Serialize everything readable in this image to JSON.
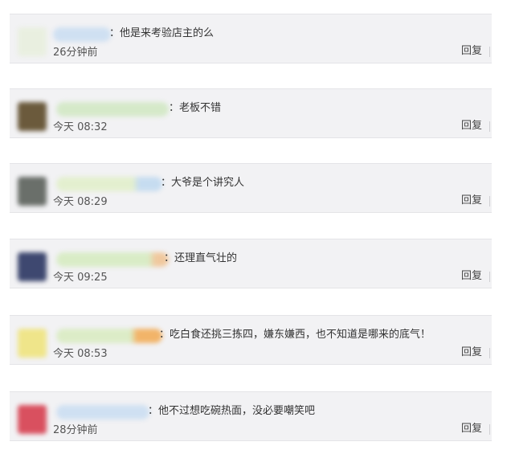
{
  "comments": [
    {
      "text": "：他是来考验店主的么",
      "time": "26分钟前",
      "reply": "回复",
      "avatar_color": "#e9efe0",
      "name_color": "#cfe0f2"
    },
    {
      "text": "：老板不错",
      "time": "今天 08:32",
      "reply": "回复",
      "avatar_color": "#6b5a3c",
      "name_color": "#d5e9c9"
    },
    {
      "text": "：大爷是个讲究人",
      "time": "今天 08:29",
      "reply": "回复",
      "avatar_color": "#6a6f6a",
      "name_color": "#e3efcf"
    },
    {
      "text": "：还理直气壮的",
      "time": "今天 09:25",
      "reply": "回复",
      "avatar_color": "#3e4870",
      "name_color": "#d9ecc6"
    },
    {
      "text": "：吃白食还挑三拣四，嫌东嫌西，也不知道是哪来的底气！",
      "time": "今天 08:53",
      "reply": "回复",
      "avatar_color": "#efe58a",
      "name_color": "#dcecc7"
    },
    {
      "text": "：他不过想吃碗热面，没必要嘲笑吧",
      "time": "28分钟前",
      "reply": "回复",
      "avatar_color": "#d9505f",
      "name_color": "#cfe0f2"
    }
  ]
}
